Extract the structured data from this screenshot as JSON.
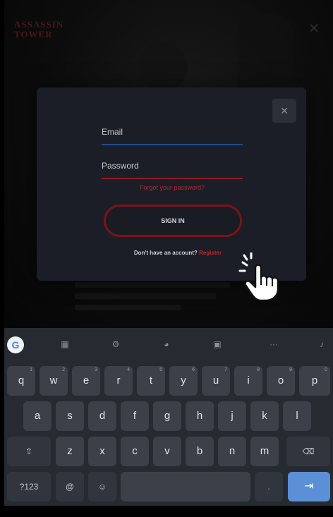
{
  "background": {
    "logo_line1": "ASSASSIN",
    "logo_line2": "TOWER",
    "close_glyph": "✕"
  },
  "modal": {
    "close_glyph": "✕",
    "email_label": "Email",
    "password_label": "Password",
    "forgot_link": "Forgot your password?",
    "signin_button": "SIGN IN",
    "register_prompt": "Don't have an account?",
    "register_link": "Register"
  },
  "keyboard": {
    "toolbar": [
      "grid-icon",
      "settings-icon",
      "palette-icon",
      "clipboard-icon",
      "more-icon",
      "mic-icon"
    ],
    "toolbar_glyphs": [
      "▦",
      "⚙",
      "◕",
      "▣",
      "···",
      "♪"
    ],
    "row1": [
      {
        "key": "q",
        "hint": "1"
      },
      {
        "key": "w",
        "hint": "2"
      },
      {
        "key": "e",
        "hint": "3"
      },
      {
        "key": "r",
        "hint": "4"
      },
      {
        "key": "t",
        "hint": "5"
      },
      {
        "key": "y",
        "hint": "6"
      },
      {
        "key": "u",
        "hint": "7"
      },
      {
        "key": "i",
        "hint": "8"
      },
      {
        "key": "o",
        "hint": "9"
      },
      {
        "key": "p",
        "hint": "0"
      }
    ],
    "row2": [
      "a",
      "s",
      "d",
      "f",
      "g",
      "h",
      "j",
      "k",
      "l"
    ],
    "row3": [
      "z",
      "x",
      "c",
      "v",
      "b",
      "n",
      "m"
    ],
    "shift_glyph": "⇧",
    "backspace_glyph": "⌫",
    "symbols_label": "?123",
    "at_label": "@",
    "emoji_glyph": "☺",
    "period_label": ".",
    "enter_glyph": "⇥"
  },
  "colors": {
    "accent_red": "#8d1a1f",
    "accent_blue": "#1f4e8c",
    "enter_key": "#5b8fd6"
  }
}
